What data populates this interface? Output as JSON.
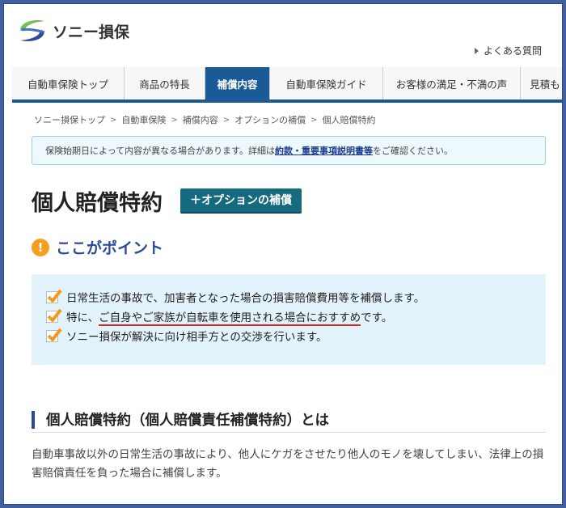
{
  "header": {
    "brand": "ソニー損保",
    "faq": "よくある質問"
  },
  "nav": {
    "items": [
      {
        "label": "自動車保険トップ",
        "width": 139
      },
      {
        "label": "商品の特長",
        "width": 100
      },
      {
        "label": "補償内容",
        "width": 80,
        "active": true
      },
      {
        "label": "自動車保険ガイド",
        "width": 140
      },
      {
        "label": "お客様の満足・不満の声",
        "width": 170
      },
      {
        "label": "見積も",
        "width": 61
      }
    ]
  },
  "breadcrumb": {
    "items": [
      "ソニー損保トップ",
      "自動車保険",
      "補償内容",
      "オプションの補償",
      "個人賠償特約"
    ],
    "sep": ">"
  },
  "notice": {
    "before": "保険始期日によって内容が異なる場合があります。詳細は",
    "link": "約款・重要事項説明書等",
    "after": "をご確認ください。"
  },
  "page": {
    "title": "個人賠償特約",
    "tag": "＋オプションの補償"
  },
  "point": {
    "icon": "!",
    "label": "ここがポイント"
  },
  "checks": {
    "row1": "日常生活の事故で、加害者となった場合の損害賠償費用等を補償します。",
    "row2_before": "特に、",
    "row2_highlight": "ご自身やご家族が自転車を使用される場合におすすめ",
    "row2_after": "です。",
    "row3": "ソニー損保が解決に向け相手方との交渉を行います。"
  },
  "section": {
    "title": "個人賠償特約（個人賠償責任補償特約）とは"
  },
  "body": {
    "text": "自動車事故以外の日常生活の事故により、他人にケガをさせたり他人のモノを壊してしまい、法律上の損害賠償責任を負った場合に補償します。"
  },
  "colors": {
    "nav_active": "#1a5a96",
    "tag": "#166a7f",
    "check": "#f39a1e",
    "highlight": "#d62828"
  }
}
